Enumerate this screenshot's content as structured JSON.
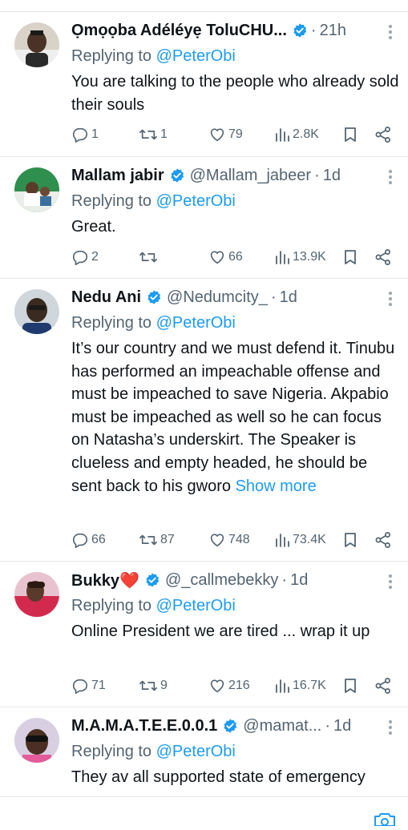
{
  "colors": {
    "accent": "#1d9bf0",
    "muted": "#536471",
    "text": "#0f1419",
    "verified": "#1d9bf0",
    "divider": "#e4e8eb"
  },
  "replying_prefix": "Replying to",
  "tweets": [
    {
      "name": "Ọmọọba Adéléyẹ ToluCHU...",
      "handle": "",
      "dot": "·",
      "time": "21h",
      "reply_to": "@PeterObi",
      "text": "You are talking to the people who already sold their souls",
      "show_more": "",
      "replies": "1",
      "retweets": "1",
      "likes": "79",
      "views": "2.8K",
      "avatar_icon": "avatar-photo"
    },
    {
      "name": "Mallam jabir",
      "handle": "@Mallam_jabeer",
      "dot": "·",
      "time": "1d",
      "reply_to": "@PeterObi",
      "text": "Great.",
      "show_more": "",
      "replies": "2",
      "retweets": "",
      "likes": "66",
      "views": "13.9K",
      "avatar_icon": "avatar-photo"
    },
    {
      "name": "Nedu Ani",
      "handle": "@Nedumcity_",
      "dot": "·",
      "time": "1d",
      "reply_to": "@PeterObi",
      "text": "It’s our country and we must defend it. Tinubu has performed an impeachable offense and must be impeached to save Nigeria. Akpabio must be impeached as well so he can focus on Natasha’s underskirt. The Speaker is clueless and empty headed, he should be sent back to his gworo",
      "show_more": "Show more",
      "replies": "66",
      "retweets": "87",
      "likes": "748",
      "views": "73.4K",
      "avatar_icon": "avatar-photo"
    },
    {
      "name": "Bukky❤️",
      "handle": "@_callmebekky",
      "dot": "·",
      "time": "1d",
      "reply_to": "@PeterObi",
      "text": "Online President we are tired ... wrap it up",
      "show_more": "",
      "replies": "71",
      "retweets": "9",
      "likes": "216",
      "views": "16.7K",
      "avatar_icon": "avatar-photo"
    },
    {
      "name": "M.A.M.A.T.E.E.0.0.1",
      "handle": "@mamat...",
      "dot": "·",
      "time": "1d",
      "reply_to": "@PeterObi",
      "text": "They av all supported state of emergency",
      "show_more": "",
      "avatar_icon": "avatar-photo"
    }
  ]
}
